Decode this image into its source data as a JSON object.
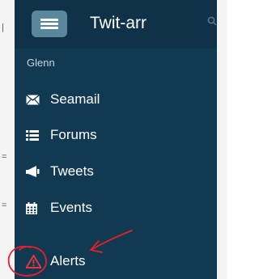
{
  "header": {
    "title": "Twit-arr"
  },
  "user": {
    "name": "Glenn"
  },
  "nav": {
    "items": [
      {
        "label": "Seamail",
        "icon": "envelope-icon"
      },
      {
        "label": "Forums",
        "icon": "list-icon"
      },
      {
        "label": "Tweets",
        "icon": "megaphone-icon"
      },
      {
        "label": "Events",
        "icon": "calendar-icon"
      },
      {
        "label": "Alerts",
        "icon": "warning-icon"
      }
    ]
  },
  "colors": {
    "drawer_bg": "#123952",
    "header_bg": "#0f3249",
    "menu_button": "#5b879c",
    "text": "#ffffff",
    "alert_icon": "#e2383a",
    "annotation": "#e4202b"
  }
}
